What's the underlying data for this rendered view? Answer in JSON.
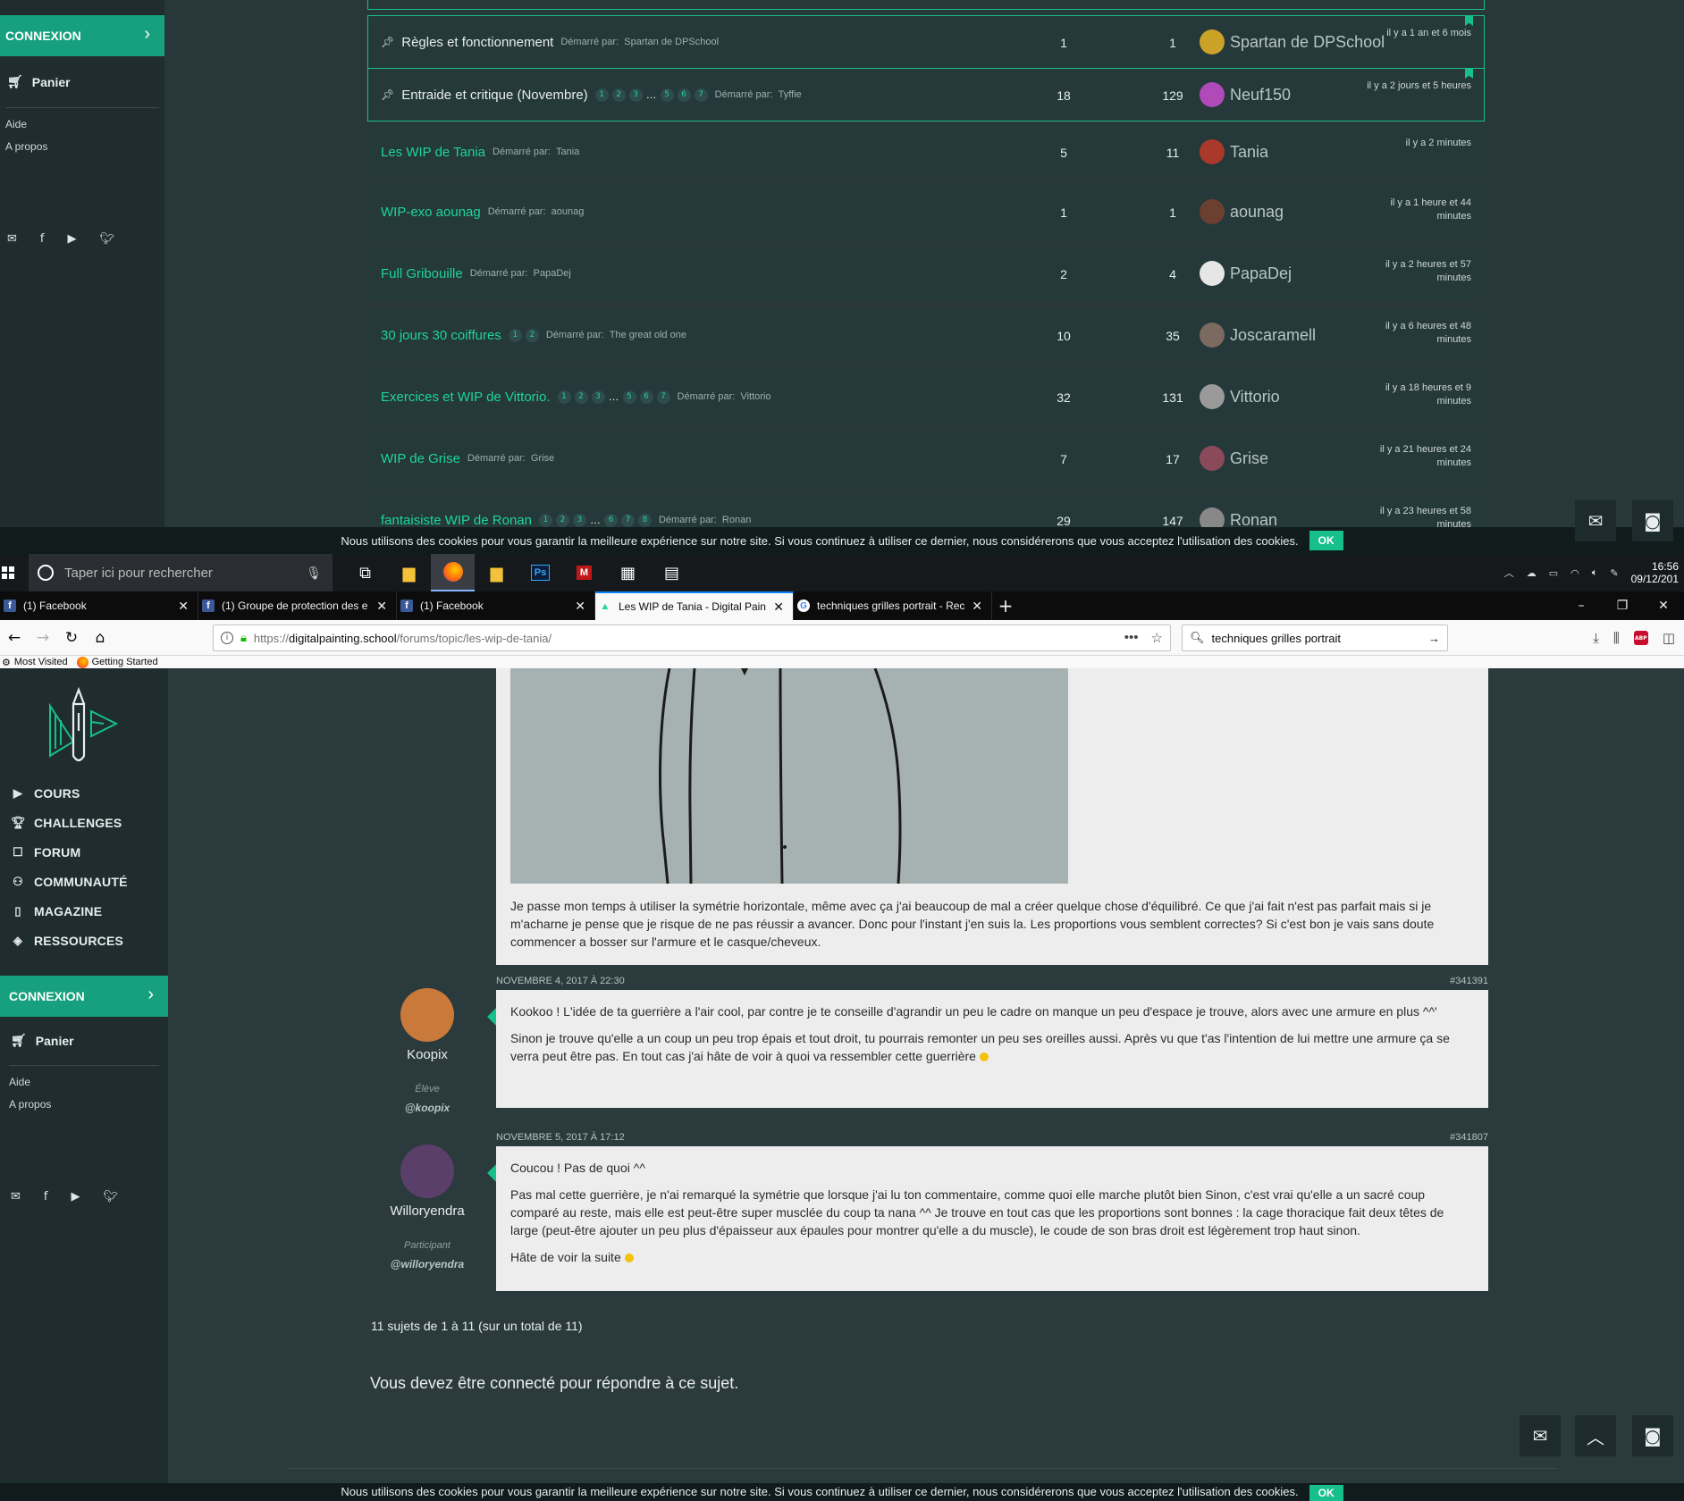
{
  "top_screenshot": {
    "sidebar": {
      "connexion": "CONNEXION",
      "cart": "Panier",
      "help": "Aide",
      "about": "A propos"
    },
    "topics": [
      {
        "title": "Règles et fonctionnement",
        "pages": [],
        "started_label": "Démarré par:",
        "started_by": "Spartan de DPSchool",
        "voices": "1",
        "posts": "1",
        "last_user": "Spartan de DPSchool",
        "freshness": "il y a 1 an et 6 mois",
        "pinned": true,
        "avatar_color": "#c9a227"
      },
      {
        "title": "Entraide et critique (Novembre)",
        "pages": [
          "1",
          "2",
          "3",
          "…",
          "5",
          "6",
          "7"
        ],
        "started_label": "Démarré par:",
        "started_by": "Tyffie",
        "voices": "18",
        "posts": "129",
        "last_user": "Neuf150",
        "freshness": "il y a 2 jours et 5 heures",
        "pinned": true,
        "avatar_color": "#b04ab8"
      },
      {
        "title": "Les WIP de Tania",
        "pages": [],
        "started_label": "Démarré par:",
        "started_by": "Tania",
        "voices": "5",
        "posts": "11",
        "last_user": "Tania",
        "freshness": "il y a 2 minutes",
        "pinned": false,
        "avatar_color": "#a8392b"
      },
      {
        "title": "WIP-exo aounag",
        "pages": [],
        "started_label": "Démarré par:",
        "started_by": "aounag",
        "voices": "1",
        "posts": "1",
        "last_user": "aounag",
        "freshness": "il y a 1 heure et 44 minutes",
        "pinned": false,
        "avatar_color": "#6b4030"
      },
      {
        "title": "Full Gribouille",
        "pages": [],
        "started_label": "Démarré par:",
        "started_by": "PapaDej",
        "voices": "2",
        "posts": "4",
        "last_user": "PapaDej",
        "freshness": "il y a 2 heures et 57 minutes",
        "pinned": false,
        "avatar_color": "#e6e6e6"
      },
      {
        "title": "30 jours 30 coiffures",
        "pages": [
          "1",
          "2"
        ],
        "started_label": "Démarré par:",
        "started_by": "The great old one",
        "voices": "10",
        "posts": "35",
        "last_user": "Joscaramell",
        "freshness": "il y a 6 heures et 48 minutes",
        "pinned": false,
        "avatar_color": "#7a6a60"
      },
      {
        "title": "Exercices et WIP de Vittorio.",
        "pages": [
          "1",
          "2",
          "3",
          "…",
          "5",
          "6",
          "7"
        ],
        "started_label": "Démarré par:",
        "started_by": "Vittorio",
        "voices": "32",
        "posts": "131",
        "last_user": "Vittorio",
        "freshness": "il y a 18 heures et 9 minutes",
        "pinned": false,
        "avatar_color": "#9a9a9a"
      },
      {
        "title": "WIP de Grise",
        "pages": [],
        "started_label": "Démarré par:",
        "started_by": "Grise",
        "voices": "7",
        "posts": "17",
        "last_user": "Grise",
        "freshness": "il y a 21 heures et 24 minutes",
        "pinned": false,
        "avatar_color": "#8a4a5a"
      },
      {
        "title": "fantaisiste WIP de Ronan",
        "pages": [
          "1",
          "2",
          "3",
          "…",
          "6",
          "7",
          "8"
        ],
        "started_label": "Démarré par:",
        "started_by": "Ronan",
        "voices": "29",
        "posts": "147",
        "last_user": "Ronan",
        "freshness": "il y a 23 heures et 58 minutes",
        "pinned": false,
        "avatar_color": "#888888"
      }
    ],
    "cookie_text": "Nous utilisons des cookies pour vous garantir la meilleure expérience sur notre site. Si vous continuez à utiliser ce dernier, nous considérerons que vous acceptez l'utilisation des cookies.",
    "cookie_ok": "OK"
  },
  "taskbar": {
    "search_placeholder": "Taper ici pour rechercher",
    "time": "16:56",
    "date": "09/12/201"
  },
  "browser": {
    "tabs": [
      {
        "label": "(1) Facebook",
        "icon": "facebook-icon",
        "active": false
      },
      {
        "label": "(1) Groupe de protection des e",
        "icon": "facebook-icon",
        "active": false
      },
      {
        "label": "(1) Facebook",
        "icon": "facebook-icon",
        "active": false
      },
      {
        "label": "Les WIP de Tania - Digital Paint",
        "icon": "site-icon",
        "active": true
      },
      {
        "label": "techniques grilles portrait - Rec",
        "icon": "google-icon",
        "active": false
      }
    ],
    "url_prefix": "https://",
    "url_domain": "digitalpainting.school",
    "url_path": "/forums/topic/les-wip-de-tania/",
    "search_value": "techniques grilles portrait",
    "bookmarks": [
      "Most Visited",
      "Getting Started"
    ]
  },
  "page": {
    "menu": [
      "COURS",
      "CHALLENGES",
      "FORUM",
      "COMMUNAUTÉ",
      "MAGAZINE",
      "RESSOURCES"
    ],
    "connexion": "CONNEXION",
    "cart": "Panier",
    "help": "Aide",
    "about": "A propos",
    "first_post_text": "Je passe mon temps à utiliser la symétrie horizontale, même avec ça j'ai beaucoup de mal a créer quelque chose d'équilibré. Ce que j'ai fait n'est pas parfait mais si je m'acharne je pense que je risque de ne pas réussir a avancer. Donc pour l'instant j'en suis la. Les proportions vous semblent correctes? Si c'est bon je vais sans doute commencer a bosser sur l'armure et le casque/cheveux.",
    "replies": [
      {
        "date": "NOVEMBRE 4, 2017 À 22:30",
        "id": "#341391",
        "author": "Koopix",
        "role": "Élève",
        "handle": "@koopix",
        "avatar_color": "#c9793a",
        "paragraphs": [
          "Kookoo ! L'idée de ta guerrière a l'air cool, par contre je te conseille d'agrandir un peu le cadre on manque un peu d'espace je trouve, alors avec une armure en plus ^^'",
          "Sinon je trouve qu'elle a un coup un peu trop épais et tout droit, tu pourrais remonter un peu ses oreilles aussi. Après vu que t'as l'intention de lui mettre une armure ça se verra peut être pas. En tout cas j'ai hâte de voir à quoi va ressembler cette guerrière"
        ]
      },
      {
        "date": "NOVEMBRE 5, 2017 À 17:12",
        "id": "#341807",
        "author": "Willoryendra",
        "role": "Participant",
        "handle": "@willoryendra",
        "avatar_color": "#5a3f6a",
        "paragraphs": [
          "Coucou ! Pas de quoi ^^",
          "Pas mal cette guerrière, je n'ai remarqué la symétrie que lorsque j'ai lu ton commentaire, comme quoi elle marche plutôt bien  Sinon, c'est vrai qu'elle a un sacré coup comparé au reste, mais elle est peut-être super musclée du coup ta nana ^^ Je trouve en tout cas que les proportions sont bonnes : la cage thoracique fait deux têtes de large (peut-être ajouter un peu plus d'épaisseur aux épaules pour montrer qu'elle a du muscle), le coude de son bras droit est légèrement trop haut sinon.",
          "Hâte de voir la suite"
        ]
      }
    ],
    "summary": "11 sujets de 1 à 11 (sur un total de 11)",
    "login_message": "Vous devez être connecté pour répondre à ce sujet.",
    "cookie_text": "Nous utilisons des cookies pour vous garantir la meilleure expérience sur notre site. Si vous continuez à utiliser ce dernier, nous considérerons que vous acceptez l'utilisation des cookies.",
    "cookie_ok": "OK"
  }
}
